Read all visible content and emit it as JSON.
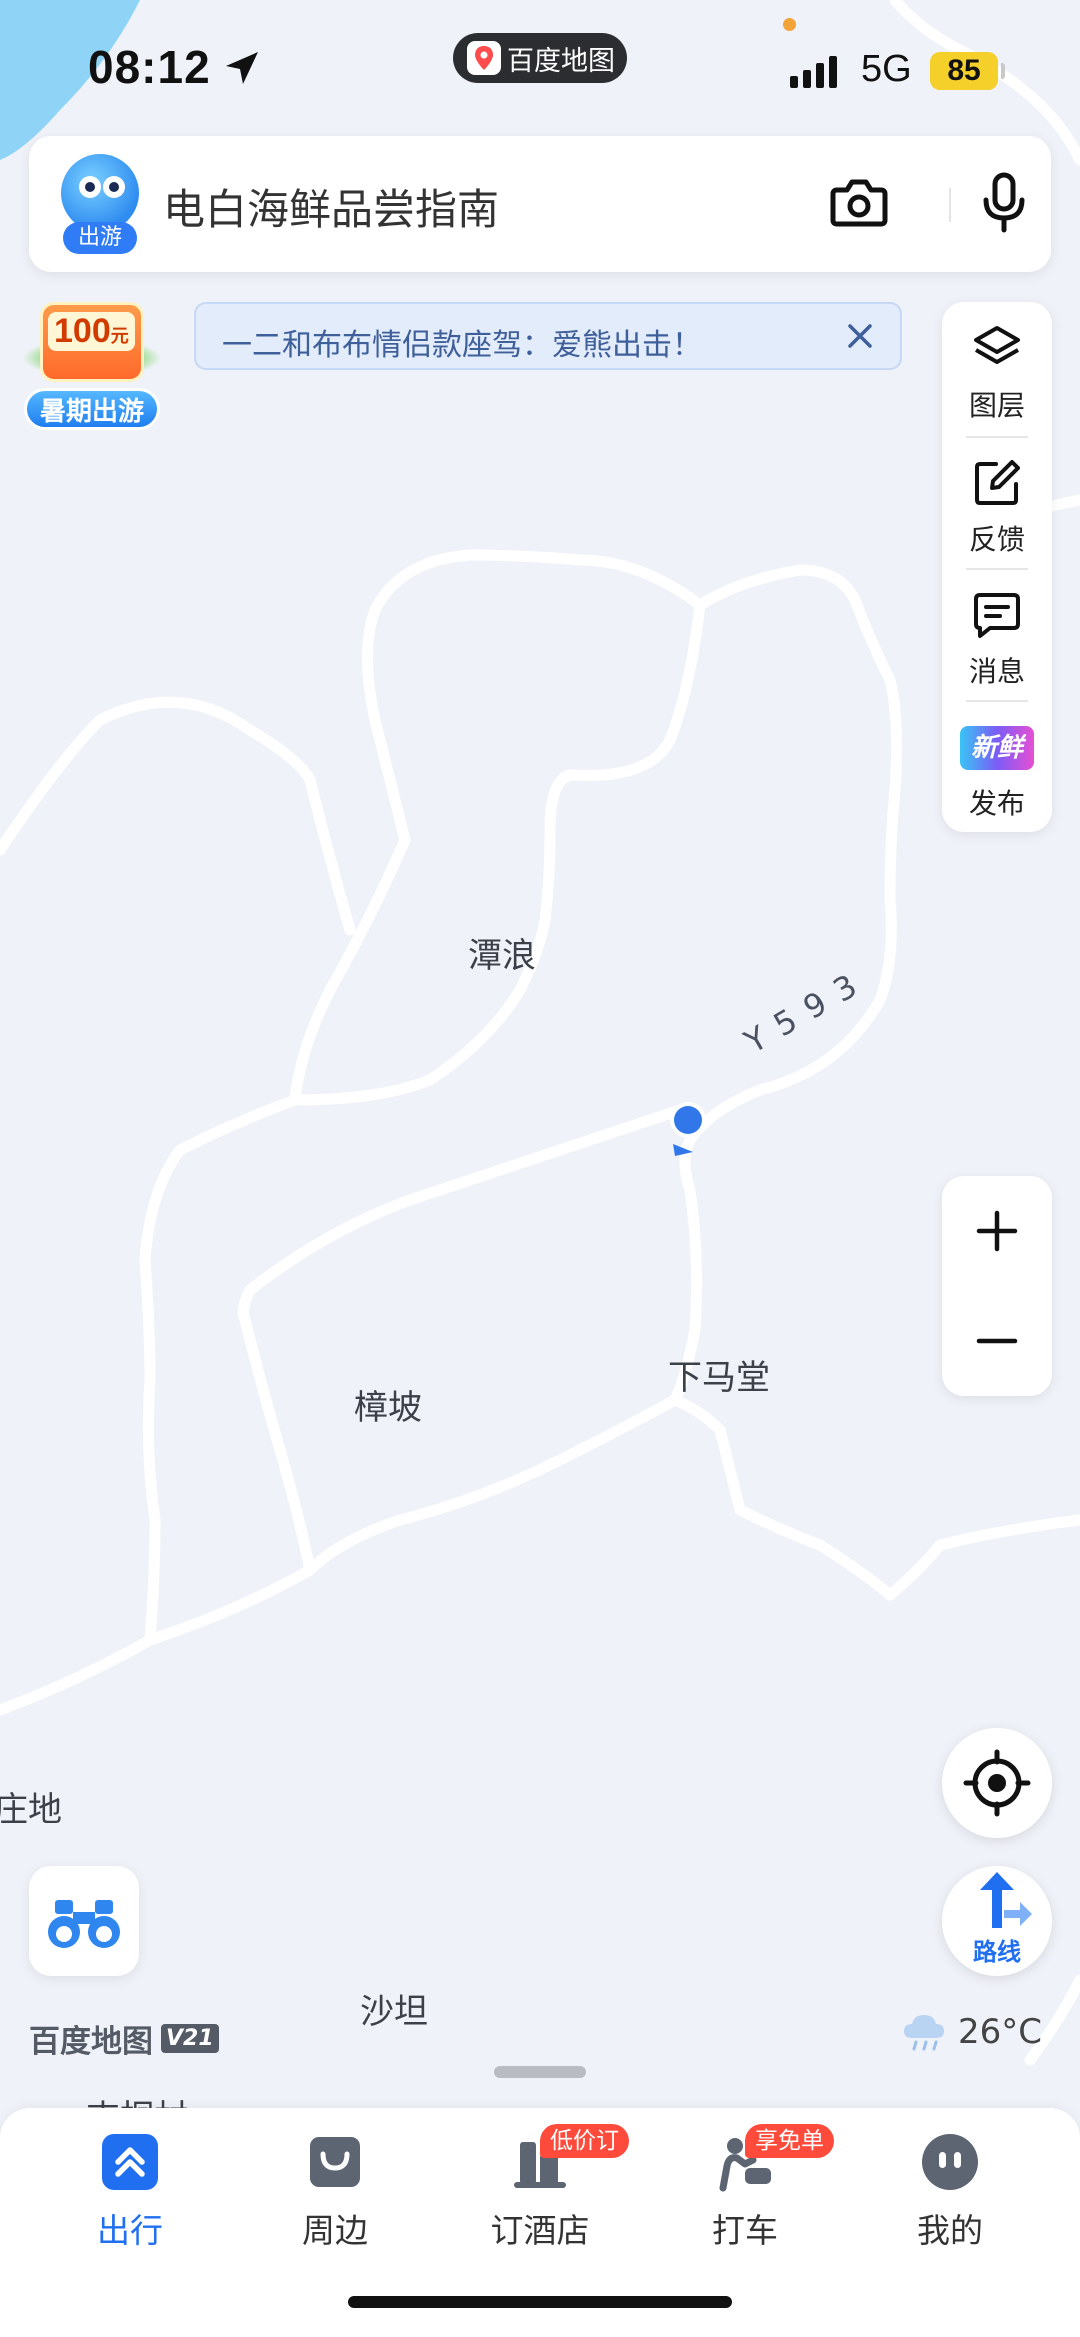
{
  "status_bar": {
    "time": "08:12",
    "app_pill": "百度地图",
    "network": "5G",
    "battery": "85"
  },
  "search": {
    "mascot_tag": "出游",
    "query": "电白海鲜品尝指南"
  },
  "promo": {
    "amount": "100",
    "unit": "元",
    "label": "暑期出游"
  },
  "notice": {
    "text": "一二和布布情侣款座驾：爱熊出击！"
  },
  "tools": [
    {
      "label": "图层",
      "icon": "layers-icon"
    },
    {
      "label": "反馈",
      "icon": "feedback-edit-icon"
    },
    {
      "label": "消息",
      "icon": "message-icon"
    },
    {
      "label": "发布",
      "icon": "new-event-icon",
      "badge": "新鲜事"
    }
  ],
  "map": {
    "road_label": "Y593",
    "places": [
      "潭浪",
      "下马堂",
      "樟坡",
      "庄地",
      "沙坦",
      "吉桐村"
    ]
  },
  "route_button": "路线",
  "brand": {
    "name": "百度地图",
    "version": "V21"
  },
  "weather": {
    "temp": "26°C",
    "icon": "cloud-rain-icon"
  },
  "tabs": [
    {
      "label": "出行",
      "icon": "travel-icon",
      "active": true
    },
    {
      "label": "周边",
      "icon": "nearby-bag-icon"
    },
    {
      "label": "订酒店",
      "icon": "hotel-icon",
      "badge": "低价订"
    },
    {
      "label": "打车",
      "icon": "taxi-icon",
      "badge": "享免单"
    },
    {
      "label": "我的",
      "icon": "profile-icon"
    }
  ],
  "colors": {
    "accent": "#1f6ff0",
    "badge": "#ff4b3b",
    "map_bg": "#eff2f8",
    "road": "#ffffff",
    "water": "#8fd4f7"
  }
}
